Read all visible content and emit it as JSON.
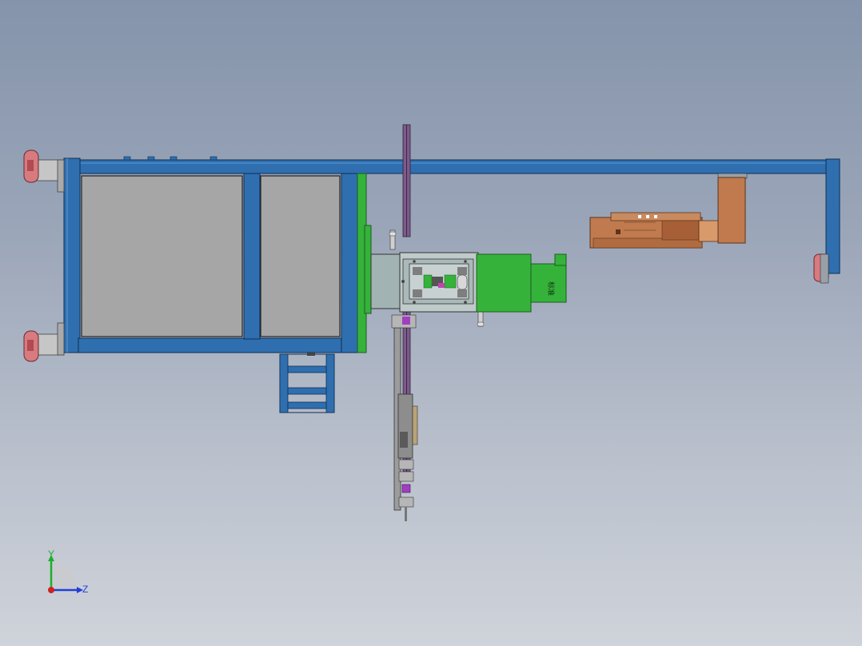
{
  "viewport": {
    "background_top": "#8594ab",
    "background_bottom": "#cfd3da"
  },
  "model": {
    "frame_color": "#2f6fb0",
    "panel_color": "#a6a6a6",
    "green_color": "#35b23a",
    "copper_color": "#c07a4e",
    "wheel_color": "#d77b80",
    "motor_label": "标准"
  },
  "triad": {
    "y_label": "Y",
    "z_label": "Z",
    "y_color": "#1fae2a",
    "z_color": "#1f3fd6",
    "x_color": "#d02020"
  }
}
